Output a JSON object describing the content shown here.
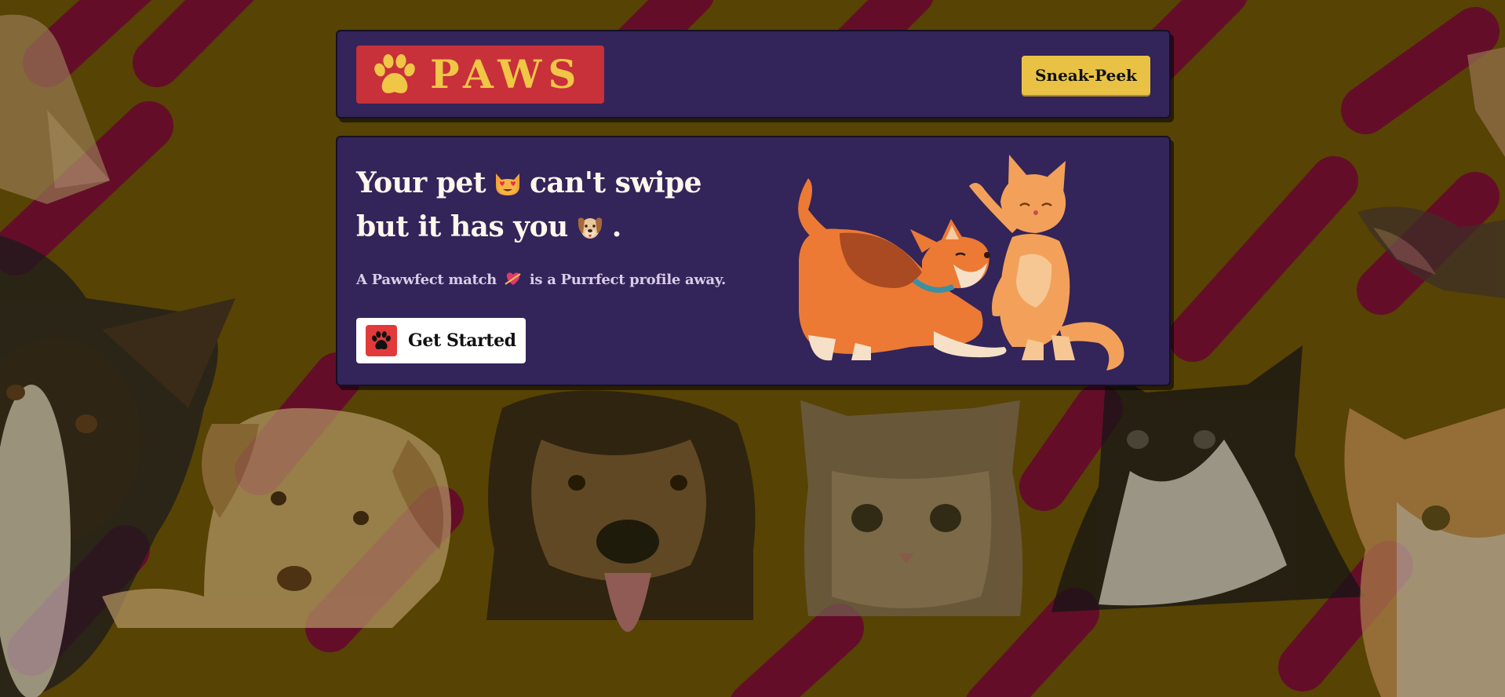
{
  "header": {
    "logo_text": "PAWS",
    "logo_icon": "paw-icon",
    "sneak_peek_label": "Sneak-Peek"
  },
  "hero": {
    "headline_part1": "Your pet",
    "headline_emoji1": "heart-eyes-cat-emoji",
    "headline_part2": "can't swipe",
    "headline_part3": "but it has you",
    "headline_emoji2": "dog-face-emoji",
    "headline_part4": ".",
    "tagline_part1": "A Pawwfect match",
    "tagline_emoji": "heart-arrow-emoji",
    "tagline_part2": "is a Purrfect profile away.",
    "cta_label": "Get Started",
    "cta_icon": "paw-icon",
    "illustration": "dog-and-cat-playing-illustration"
  },
  "background": {
    "description_icons": [
      "puppy-photo",
      "kitten-photo"
    ]
  },
  "colors": {
    "background": "#6b5206",
    "stripe": "#7a1033",
    "card": "#33245a",
    "logo_bg": "#c8303a",
    "logo_text": "#efc646",
    "button_yellow": "#e9c245",
    "cta_icon_bg": "#e23a3a"
  }
}
